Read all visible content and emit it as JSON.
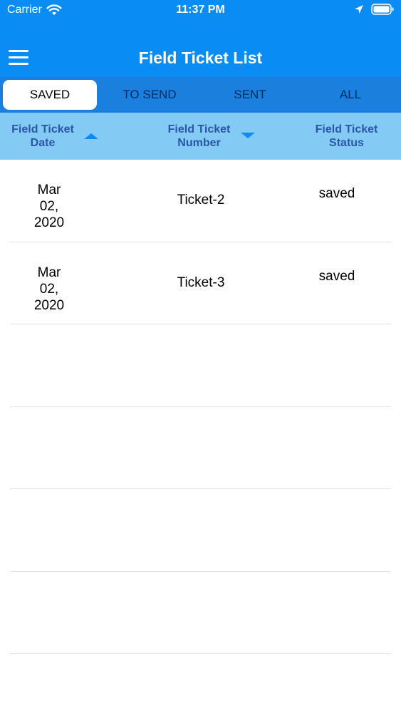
{
  "status_bar": {
    "carrier": "Carrier",
    "time": "11:37 PM"
  },
  "nav": {
    "title": "Field Ticket List"
  },
  "tabs": [
    {
      "label": "SAVED",
      "active": true
    },
    {
      "label": "TO SEND",
      "active": false
    },
    {
      "label": "SENT",
      "active": false
    },
    {
      "label": "ALL",
      "active": false
    }
  ],
  "table": {
    "headers": {
      "date": "Field Ticket\nDate",
      "number": "Field Ticket\nNumber",
      "status": "Field Ticket\nStatus"
    },
    "rows": [
      {
        "date": "Mar\n02,\n2020",
        "number": "Ticket-2",
        "status": "saved"
      },
      {
        "date": "Mar\n02,\n2020",
        "number": "Ticket-3",
        "status": "saved"
      },
      {
        "date": "",
        "number": "",
        "status": ""
      },
      {
        "date": "",
        "number": "",
        "status": ""
      },
      {
        "date": "",
        "number": "",
        "status": ""
      },
      {
        "date": "",
        "number": "",
        "status": ""
      }
    ]
  },
  "icons": {
    "wifi": "wifi-icon",
    "location": "location-arrow-icon",
    "battery": "battery-icon",
    "menu": "hamburger-menu-icon",
    "sort_date": "sort-ascending-icon",
    "sort_number": "sort-descending-icon"
  },
  "colors": {
    "primary": "#0a8cf5",
    "tab_bar": "#1a7fdd",
    "header_bg": "#83cbf4",
    "header_text": "#2a56a8"
  }
}
